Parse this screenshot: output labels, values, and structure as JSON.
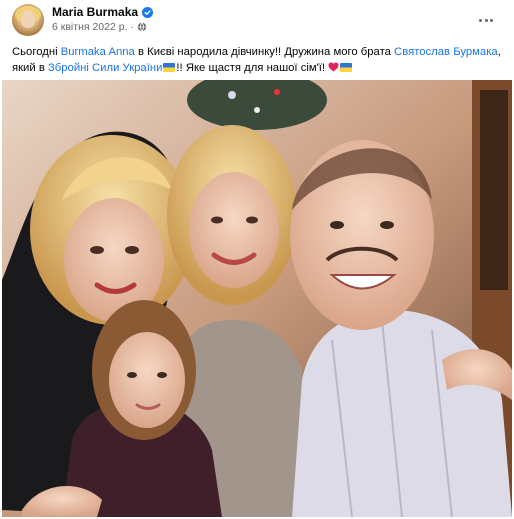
{
  "post": {
    "author": "Maria Burmaka",
    "date": "6 квітня 2022 р.",
    "date_separator": "·",
    "text_parts": {
      "t1": "Сьогодні ",
      "mention1": "Burmaka Anna",
      "t2": " в Києві народила дівчинку!! Дружина мого брата ",
      "mention2": "Святослав Бурмака",
      "t3": ",",
      "t4": "який в ",
      "mention3": "Збройні Сили України",
      "t5": "!! Яке щастя для нашої сім'ї!"
    }
  },
  "icons": {
    "avatar": "avatar",
    "verified": "verified-badge-icon",
    "globe": "globe-icon",
    "more": "more-options-icon",
    "flag": "ukraine-flag-icon",
    "heart": "red-heart-icon"
  },
  "colors": {
    "mention": "#1b74e4",
    "verified": "#1877f2",
    "meta": "#65676b",
    "heart": "#e0245e"
  }
}
